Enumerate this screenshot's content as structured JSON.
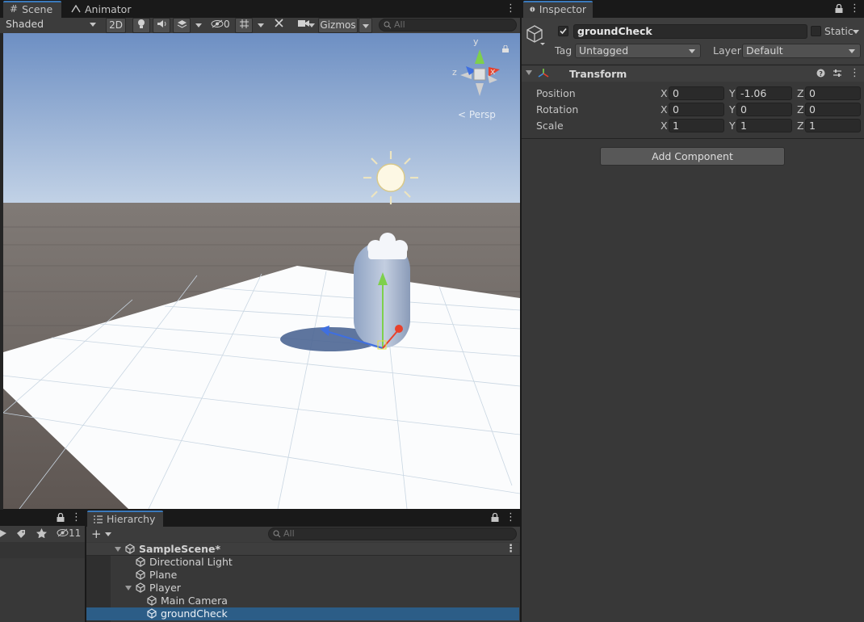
{
  "scene_panel": {
    "tabs": [
      {
        "label": "Scene",
        "icon": "grid-icon",
        "active": true
      },
      {
        "label": "Animator",
        "icon": "animator-icon",
        "active": false
      }
    ],
    "toolbar": {
      "draw_mode": "Shaded",
      "mode_2d": "2D",
      "hidden_count": "0",
      "gizmos": "Gizmos",
      "search_placeholder": "All"
    },
    "persp_label": "Persp",
    "gizmo_axes": {
      "x": "x",
      "y": "y",
      "z": "z"
    }
  },
  "inspector": {
    "tab": "Inspector",
    "object_name": "groundCheck",
    "static_label": "Static",
    "tag_label": "Tag",
    "tag_value": "Untagged",
    "layer_label": "Layer",
    "layer_value": "Default",
    "component": "Transform",
    "rows": [
      {
        "label": "Position",
        "x": "0",
        "y": "-1.06",
        "z": "0"
      },
      {
        "label": "Rotation",
        "x": "0",
        "y": "0",
        "z": "0"
      },
      {
        "label": "Scale",
        "x": "1",
        "y": "1",
        "z": "1"
      }
    ],
    "axis": {
      "x": "X",
      "y": "Y",
      "z": "Z"
    },
    "add_component": "Add Component"
  },
  "project_panel": {
    "hidden_count": "11"
  },
  "hierarchy": {
    "tab": "Hierarchy",
    "search_placeholder": "All",
    "scene": "SampleScene*",
    "items": [
      {
        "label": "Directional Light",
        "depth": 1,
        "selected": false,
        "expanded": null
      },
      {
        "label": "Plane",
        "depth": 1,
        "selected": false,
        "expanded": null
      },
      {
        "label": "Player",
        "depth": 1,
        "selected": false,
        "expanded": true
      },
      {
        "label": "Main Camera",
        "depth": 2,
        "selected": false,
        "expanded": null
      },
      {
        "label": "groundCheck",
        "depth": 2,
        "selected": true,
        "expanded": null
      }
    ]
  },
  "colors": {
    "sky_top": "#6f90c2",
    "sky_bottom": "#c4d3e6",
    "ground": "#6b6460",
    "selection": "#2c5d87",
    "accent_tab": "#3a79bb"
  }
}
